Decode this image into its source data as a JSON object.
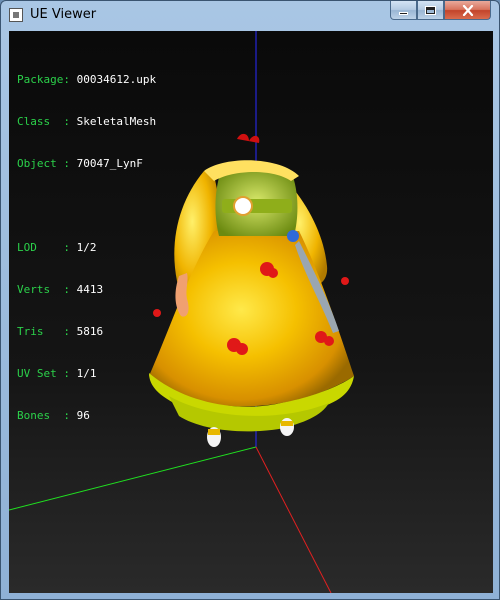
{
  "window": {
    "title": "UE Viewer",
    "controls": [
      "minimize",
      "maximize",
      "close"
    ]
  },
  "info": {
    "group1": [
      {
        "label": "Package",
        "value": "00034612.upk"
      },
      {
        "label": "Class",
        "value": "SkeletalMesh"
      },
      {
        "label": "Object",
        "value": "70047_LynF"
      }
    ],
    "group2": [
      {
        "label": "LOD",
        "value": "1/2"
      },
      {
        "label": "Verts",
        "value": "4413"
      },
      {
        "label": "Tris",
        "value": "5816"
      },
      {
        "label": "UV Set",
        "value": "1/1"
      },
      {
        "label": "Bones",
        "value": "96"
      }
    ]
  },
  "axes": {
    "x_color": "#ff2020",
    "y_color": "#20ff20",
    "z_color": "#2020ff"
  },
  "model": {
    "description_icon": "skeletal-mesh-character-icon",
    "dress_color": "#f5c400"
  }
}
